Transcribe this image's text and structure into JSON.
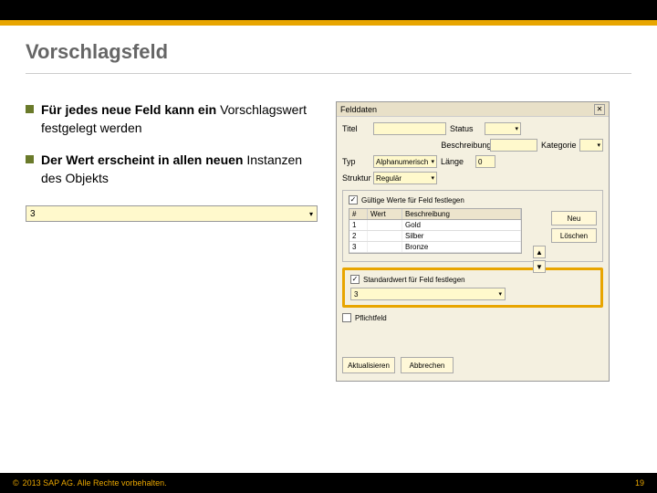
{
  "slide": {
    "title": "Vorschlagsfeld",
    "bullets": [
      {
        "bold": "Für jedes neue Feld kann ein",
        "rest": "Vorschlagswert festgelegt werden"
      },
      {
        "bold": "Der Wert erscheint in allen neuen",
        "rest": "Instanzen des Objekts"
      }
    ],
    "sample_value": "3"
  },
  "dialog": {
    "title": "Felddaten",
    "close": "✕",
    "labels": {
      "title": "Titel",
      "status": "Status",
      "desc": "Beschreibung",
      "cat": "Kategorie",
      "type": "Typ",
      "length": "Länge",
      "struct": "Struktur"
    },
    "values": {
      "title": "",
      "status": "",
      "desc": "",
      "cat": "",
      "type": "Alphanumerisch",
      "length": "0",
      "struct": "Regulär"
    },
    "valid_check": "Gültige Werte für Feld festlegen",
    "table": {
      "headers": {
        "num": "#",
        "val": "Wert",
        "desc": "Beschreibung"
      },
      "rows": [
        {
          "n": "1",
          "v": "",
          "d": "Gold"
        },
        {
          "n": "2",
          "v": "",
          "d": "Silber"
        },
        {
          "n": "3",
          "v": "",
          "d": "Bronze"
        }
      ]
    },
    "side_buttons": {
      "new": "Neu",
      "delete": "Löschen"
    },
    "default_check": "Standardwert für Feld festlegen",
    "default_value": "3",
    "mandatory_check": "Pflichtfeld",
    "bottom_buttons": {
      "update": "Aktualisieren",
      "cancel": "Abbrechen"
    }
  },
  "footer": {
    "copyright": "2013 SAP AG. Alle Rechte vorbehalten.",
    "page": "19"
  }
}
